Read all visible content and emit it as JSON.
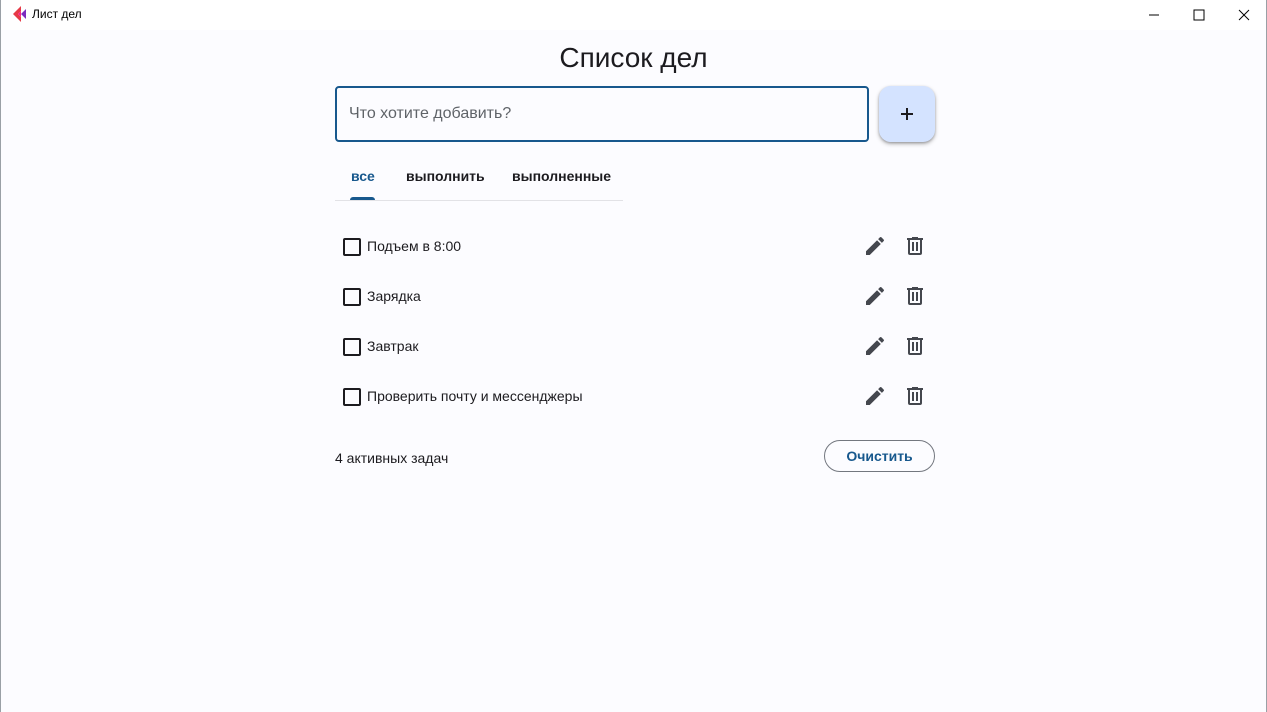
{
  "window": {
    "title": "Лист дел"
  },
  "page": {
    "heading": "Список дел"
  },
  "input": {
    "placeholder": "Что хотите добавить?",
    "value": ""
  },
  "add_button": {
    "label": "+"
  },
  "tabs": [
    {
      "label": "все",
      "active": true
    },
    {
      "label": "выполнить",
      "active": false
    },
    {
      "label": "выполненные",
      "active": false
    }
  ],
  "tasks": [
    {
      "text": "Подъем в 8:00",
      "done": false
    },
    {
      "text": "Зарядка",
      "done": false
    },
    {
      "text": "Завтрак",
      "done": false
    },
    {
      "text": "Проверить почту и мессенджеры",
      "done": false
    }
  ],
  "footer": {
    "active_count": "4 активных задач",
    "clear_label": "Очистить"
  },
  "icons": {
    "edit": "pencil-icon",
    "delete": "trash-icon",
    "add": "plus-icon"
  },
  "colors": {
    "accent": "#17588d",
    "fab_bg": "#d4e3ff",
    "background": "#fcfcff"
  }
}
